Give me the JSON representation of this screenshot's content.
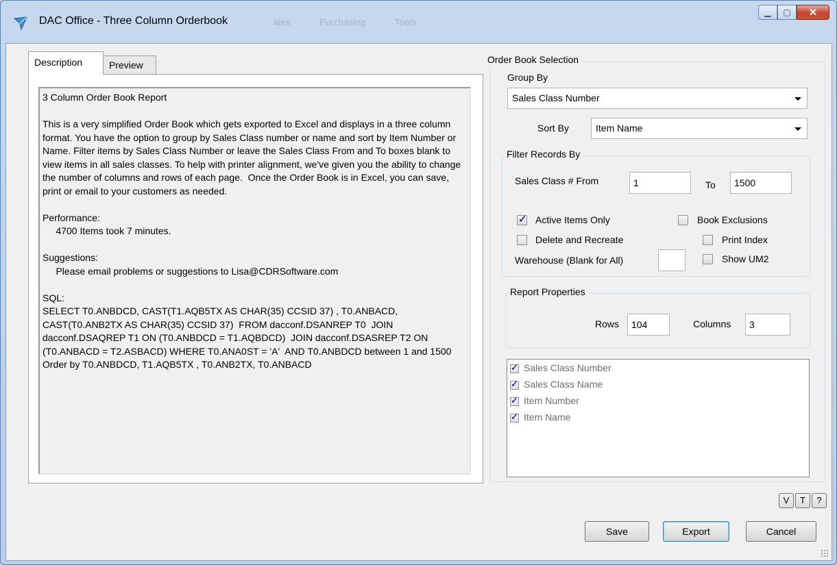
{
  "window": {
    "title": "DAC Office - Three Column Orderbook",
    "background_menu": [
      "ales",
      "Purchasing",
      "Tools"
    ],
    "minimize_icon": "minimize-icon",
    "maximize_icon": "maximize-icon",
    "close_icon": "close-icon"
  },
  "tabs": {
    "description": "Description",
    "preview": "Preview"
  },
  "description_text": "3 Column Order Book Report\n\nThis is a very simplified Order Book which gets exported to Excel and displays in a three column format. You have the option to group by Sales Class number or name and sort by Item Number or Name. Filter items by Sales Class Number or leave the Sales Class From and To boxes blank to view items in all sales classes. To help with printer alignment, we've given you the ability to change the number of columns and rows of each page.  Once the Order Book is in Excel, you can save, print or email to your customers as needed.\n\nPerformance:\n     4700 Items took 7 minutes.\n\nSuggestions:\n     Please email problems or suggestions to Lisa@CDRSoftware.com\n\nSQL:\nSELECT T0.ANBDCD, CAST(T1.AQB5TX AS CHAR(35) CCSID 37) , T0.ANBACD, CAST(T0.ANB2TX AS CHAR(35) CCSID 37)  FROM dacconf.DSANREP T0  JOIN dacconf.DSAQREP T1 ON (T0.ANBDCD = T1.AQBDCD)  JOIN dacconf.DSASREP T2 ON (T0.ANBACD = T2.ASBACD) WHERE T0.ANA0ST = 'A'  AND T0.ANBDCD between 1 and 1500 Order by T0.ANBDCD, T1.AQB5TX , T0.ANB2TX, T0.ANBACD",
  "selection": {
    "legend": "Order Book Selection",
    "group_by_label": "Group By",
    "group_by_value": "Sales Class Number",
    "sort_by_label": "Sort By",
    "sort_by_value": "Item Name",
    "filter": {
      "legend": "Filter Records By",
      "from_label": "Sales Class # From",
      "from_value": "1",
      "to_label": "To",
      "to_value": "1500",
      "active_items_label": "Active Items Only",
      "active_items_checked": true,
      "book_exclusions_label": "Book Exclusions",
      "book_exclusions_checked": false,
      "delete_recreate_label": "Delete and Recreate",
      "delete_recreate_checked": false,
      "print_index_label": "Print Index",
      "print_index_checked": false,
      "warehouse_label": "Warehouse (Blank for All)",
      "warehouse_value": "",
      "show_um2_label": "Show UM2",
      "show_um2_checked": false
    },
    "report": {
      "legend": "Report Properties",
      "rows_label": "Rows",
      "rows_value": "104",
      "columns_label": "Columns",
      "columns_value": "3"
    },
    "columns_list": [
      {
        "label": "Sales Class Number",
        "checked": true
      },
      {
        "label": "Sales Class Name",
        "checked": true
      },
      {
        "label": "Item Number",
        "checked": true
      },
      {
        "label": "Item Name",
        "checked": true
      }
    ]
  },
  "mini_buttons": {
    "v": "V",
    "t": "T",
    "help": "?"
  },
  "buttons": {
    "save": "Save",
    "export": "Export",
    "cancel": "Cancel"
  },
  "colors": {
    "title_bar": "#c6d8ee",
    "close_button": "#c5442f",
    "panel_bg": "#f0f0f0",
    "checkmark": "#2a3f91"
  }
}
